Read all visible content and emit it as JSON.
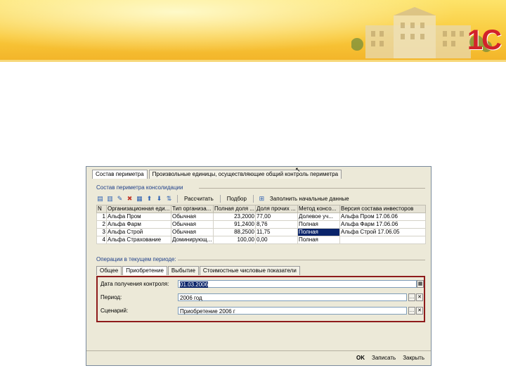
{
  "logo_text": "1С",
  "tabs_top": [
    {
      "label": "Состав периметра",
      "active": true
    },
    {
      "label": "Произвольные единицы, осуществляющие общий контроль периметра",
      "active": false
    }
  ],
  "group_title": "Состав периметра консолидации",
  "toolbar": {
    "calc_label": "Рассчитать",
    "select_label": "Подбор",
    "fill_label": "Заполнить начальные данные"
  },
  "table": {
    "headers": [
      "N",
      "Организационная еди...",
      "Тип организа...",
      "Полная доля ...",
      "Доля прочих ...",
      "Метод консо...",
      "Версия состава инвесторов"
    ],
    "rows": [
      [
        "1",
        "Альфа Пром",
        "Обычная",
        "23,2000",
        "77,00",
        "Долевое уч...",
        "Альфа Пром 17.06.06"
      ],
      [
        "2",
        "Альфа Фарм",
        "Обычная",
        "91,2400",
        "8,76",
        "Полная",
        "Альфа Фарм 17.06.06"
      ],
      [
        "3",
        "Альфа Строй",
        "Обычная",
        "88,2500",
        "11,75",
        "Полная",
        "Альфа Строй 17.06.05"
      ],
      [
        "4",
        "Альфа Страхование",
        "Доминирующ...",
        "100,00",
        "0,00",
        "Полная",
        ""
      ]
    ],
    "selected_row": 2,
    "selected_col": 5
  },
  "operations_title": "Операции в текущем периоде:",
  "tabs_bottom": [
    {
      "label": "Общее",
      "active": false
    },
    {
      "label": "Приобретение",
      "active": true
    },
    {
      "label": "Выбытие",
      "active": false
    },
    {
      "label": "Стоимостные числовые показатели",
      "active": false
    }
  ],
  "detail": {
    "date_label": "Дата получения контроля:",
    "date_value": "01.03.2006",
    "period_label": "Период:",
    "period_value": "2006 год",
    "scenario_label": "Сценарий:",
    "scenario_value": "Приобретение 2006 г"
  },
  "footer": {
    "ok_label": "OK",
    "save_label": "Записать",
    "close_label": "Закрыть"
  }
}
